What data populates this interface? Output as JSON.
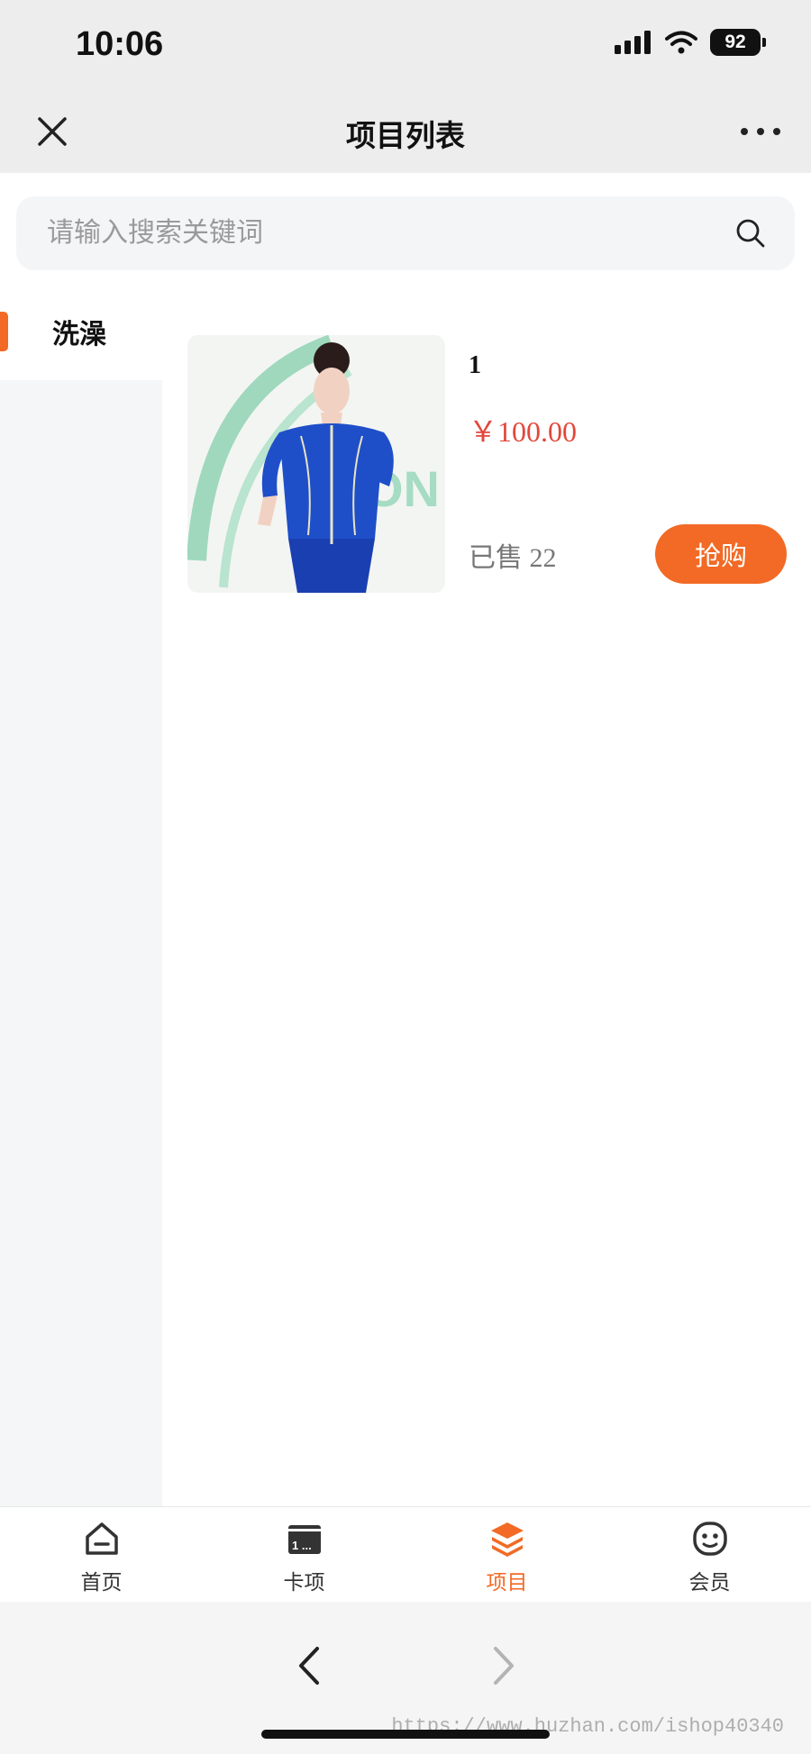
{
  "status_bar": {
    "time": "10:06",
    "battery": "92"
  },
  "nav": {
    "title": "项目列表"
  },
  "search": {
    "placeholder": "请输入搜索关键词"
  },
  "sidebar": {
    "items": [
      {
        "label": "洗澡",
        "active": true
      }
    ]
  },
  "products": [
    {
      "name": "1",
      "price": "￥100.00",
      "sold": "已售 22",
      "buy_label": "抢购"
    }
  ],
  "tabs": [
    {
      "label": "首页",
      "icon": "home-icon",
      "active": false
    },
    {
      "label": "卡项",
      "icon": "card-icon",
      "active": false
    },
    {
      "label": "项目",
      "icon": "layers-icon",
      "active": true
    },
    {
      "label": "会员",
      "icon": "member-icon",
      "active": false
    }
  ],
  "card_icon_text": "1 ...",
  "watermark": "https://www.huzhan.com/ishop40340",
  "colors": {
    "accent": "#f26a25",
    "price": "#e2473b",
    "page_bg": "#ededed"
  }
}
